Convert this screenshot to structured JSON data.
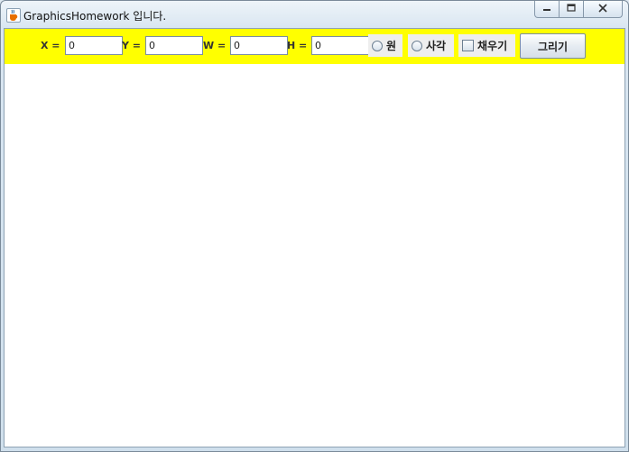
{
  "window": {
    "title": "GraphicsHomework 입니다.",
    "icon": "java-cup-icon",
    "controls": {
      "minimize_icon": "minimize-icon",
      "maximize_icon": "maximize-icon",
      "close_icon": "close-icon"
    }
  },
  "toolbar": {
    "background": "#ffff00",
    "x_label": "X =",
    "x_value": "0",
    "y_label": "Y =",
    "y_value": "0",
    "w_label": "W =",
    "w_value": "0",
    "h_label": "H =",
    "h_value": "0",
    "circle_label": "원",
    "rect_label": "사각",
    "fill_label": "채우기",
    "draw_label": "그리기"
  }
}
